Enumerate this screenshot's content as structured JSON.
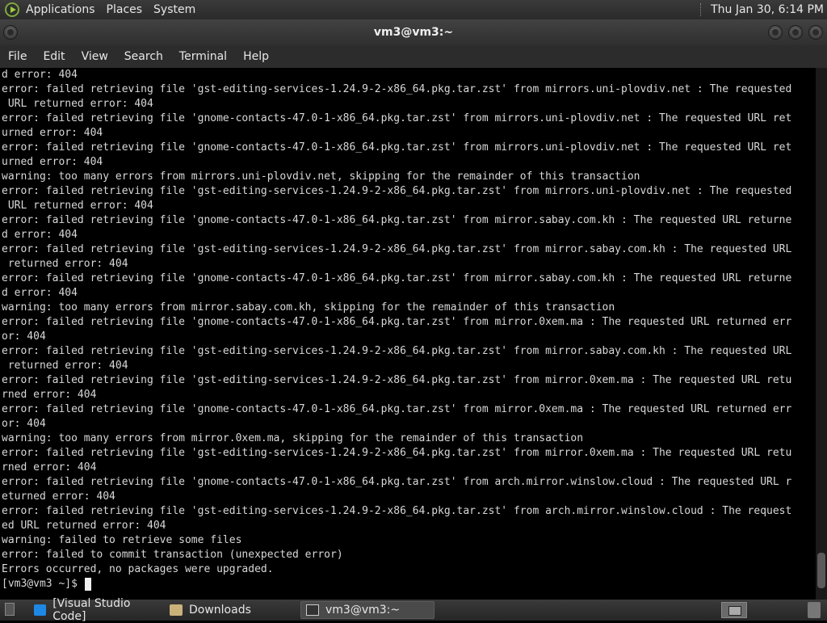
{
  "top_panel": {
    "menus": [
      "Applications",
      "Places",
      "System"
    ],
    "clock": "Thu Jan 30,  6:14 PM"
  },
  "window": {
    "title": "vm3@vm3:~"
  },
  "menubar": [
    "File",
    "Edit",
    "View",
    "Search",
    "Terminal",
    "Help"
  ],
  "terminal": {
    "lines": [
      "d error: 404",
      "error: failed retrieving file 'gst-editing-services-1.24.9-2-x86_64.pkg.tar.zst' from mirrors.uni-plovdiv.net : The requested",
      " URL returned error: 404",
      "error: failed retrieving file 'gnome-contacts-47.0-1-x86_64.pkg.tar.zst' from mirrors.uni-plovdiv.net : The requested URL ret",
      "urned error: 404",
      "error: failed retrieving file 'gnome-contacts-47.0-1-x86_64.pkg.tar.zst' from mirrors.uni-plovdiv.net : The requested URL ret",
      "urned error: 404",
      "warning: too many errors from mirrors.uni-plovdiv.net, skipping for the remainder of this transaction",
      "error: failed retrieving file 'gst-editing-services-1.24.9-2-x86_64.pkg.tar.zst' from mirrors.uni-plovdiv.net : The requested",
      " URL returned error: 404",
      "error: failed retrieving file 'gnome-contacts-47.0-1-x86_64.pkg.tar.zst' from mirror.sabay.com.kh : The requested URL returne",
      "d error: 404",
      "error: failed retrieving file 'gst-editing-services-1.24.9-2-x86_64.pkg.tar.zst' from mirror.sabay.com.kh : The requested URL",
      " returned error: 404",
      "error: failed retrieving file 'gnome-contacts-47.0-1-x86_64.pkg.tar.zst' from mirror.sabay.com.kh : The requested URL returne",
      "d error: 404",
      "warning: too many errors from mirror.sabay.com.kh, skipping for the remainder of this transaction",
      "error: failed retrieving file 'gnome-contacts-47.0-1-x86_64.pkg.tar.zst' from mirror.0xem.ma : The requested URL returned err",
      "or: 404",
      "error: failed retrieving file 'gst-editing-services-1.24.9-2-x86_64.pkg.tar.zst' from mirror.sabay.com.kh : The requested URL",
      " returned error: 404",
      "error: failed retrieving file 'gst-editing-services-1.24.9-2-x86_64.pkg.tar.zst' from mirror.0xem.ma : The requested URL retu",
      "rned error: 404",
      "error: failed retrieving file 'gnome-contacts-47.0-1-x86_64.pkg.tar.zst' from mirror.0xem.ma : The requested URL returned err",
      "or: 404",
      "warning: too many errors from mirror.0xem.ma, skipping for the remainder of this transaction",
      "error: failed retrieving file 'gst-editing-services-1.24.9-2-x86_64.pkg.tar.zst' from mirror.0xem.ma : The requested URL retu",
      "rned error: 404",
      "error: failed retrieving file 'gnome-contacts-47.0-1-x86_64.pkg.tar.zst' from arch.mirror.winslow.cloud : The requested URL r",
      "eturned error: 404",
      "error: failed retrieving file 'gst-editing-services-1.24.9-2-x86_64.pkg.tar.zst' from arch.mirror.winslow.cloud : The request",
      "ed URL returned error: 404",
      "warning: failed to retrieve some files",
      "error: failed to commit transaction (unexpected error)",
      "Errors occurred, no packages were upgraded."
    ],
    "prompt": "[vm3@vm3 ~]$ "
  },
  "taskbar": {
    "tasks": [
      {
        "label": "[Visual Studio Code]",
        "icon": "vscode-icon"
      },
      {
        "label": "Downloads",
        "icon": "folder-icon"
      },
      {
        "label": "vm3@vm3:~",
        "icon": "terminal-icon"
      }
    ]
  }
}
